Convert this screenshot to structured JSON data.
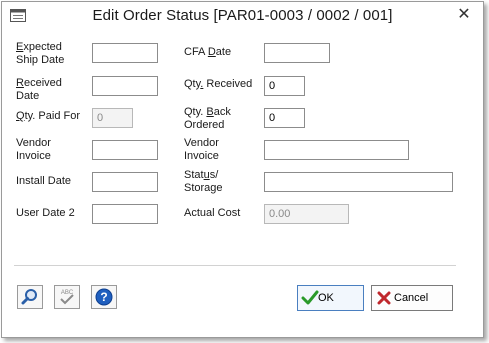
{
  "window": {
    "title": "Edit Order Status [PAR01-0003 / 0002 / 001]"
  },
  "fields": {
    "expected_ship_date": {
      "label_accel": "E",
      "label_rest": "xpected",
      "label_line2": "Ship Date",
      "value": ""
    },
    "received_date": {
      "label_accel": "R",
      "label_rest": "eceived",
      "label_line2": "Date",
      "value": ""
    },
    "qty_paid_for": {
      "label_accel": "Q",
      "label_rest": "ty. Paid For",
      "value": "0"
    },
    "vendor_invoice_left": {
      "label_line1": "Vendor",
      "label_line2": "Invoice",
      "value": ""
    },
    "install_date": {
      "label": "Install Date",
      "value": ""
    },
    "user_date_2": {
      "label": "User Date 2",
      "value": ""
    },
    "cfa_date": {
      "label_pre": "CFA ",
      "label_accel": "D",
      "label_rest": "ate",
      "value": ""
    },
    "qty_received": {
      "label_pre": "Qty",
      "label_accel": ".",
      "label_rest": " Received",
      "value": "0"
    },
    "qty_back_ordered": {
      "label_pre": "Qty. ",
      "label_accel": "B",
      "label_rest": "ack",
      "label_line2": "Ordered",
      "value": "0"
    },
    "vendor_invoice_right": {
      "label_line1": "Vendor",
      "label_line2": "Invoice",
      "value": ""
    },
    "status_storage": {
      "label_pre": "Stat",
      "label_accel": "u",
      "label_rest": "s/",
      "label_line2": "Storage",
      "value": ""
    },
    "actual_cost": {
      "label": "Actual Cost",
      "value": "0.00"
    }
  },
  "buttons": {
    "ok_label": "OK",
    "cancel_label": "Cancel",
    "spell_icon_text": "ABC"
  },
  "icons": {
    "app": "window-icon",
    "close": "close-icon",
    "search": "magnifier-icon",
    "spell": "spellcheck-icon",
    "help": "help-icon",
    "ok": "check-icon",
    "cancel": "x-icon"
  },
  "colors": {
    "ok_check": "#2a9a2a",
    "cancel_x": "#c0282d",
    "help_blue": "#1f5fbf",
    "search_blue": "#2a5fa8"
  }
}
